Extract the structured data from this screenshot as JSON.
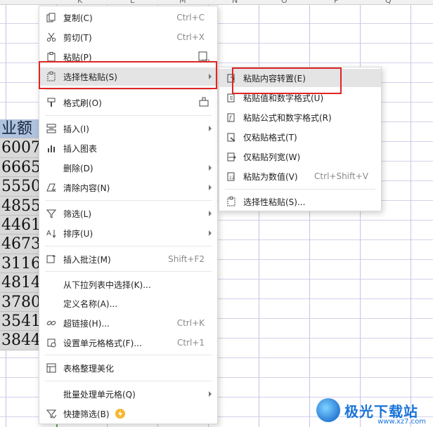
{
  "sheet": {
    "column_letters": [
      "K",
      "L",
      "M",
      "N",
      "O",
      "P",
      "Q"
    ],
    "header_cell": "业额",
    "cells": [
      "6007",
      "6665",
      "5550",
      "4855",
      "4461",
      "4673",
      "3116",
      "4814",
      "3780",
      "3541",
      "3844"
    ]
  },
  "main_menu": {
    "items": [
      {
        "label": "复制(C)",
        "shortcut": "Ctrl+C",
        "icon": "copy-icon"
      },
      {
        "label": "剪切(T)",
        "shortcut": "Ctrl+X",
        "icon": "scissors-icon"
      },
      {
        "label": "粘贴(P)",
        "shortcut": "",
        "icon": "paste-icon",
        "right_icon": "paste-value-icon"
      },
      {
        "label": "选择性粘贴(S)",
        "shortcut": "",
        "icon": "paste-special-icon",
        "submenu": true,
        "highlighted": true
      },
      {
        "label": "格式刷(O)",
        "shortcut": "",
        "icon": "format-brush-icon",
        "right_icon": "brush-icon"
      },
      {
        "label": "插入(I)",
        "shortcut": "",
        "icon": "insert-icon",
        "submenu": true
      },
      {
        "label": "插入图表",
        "shortcut": "",
        "icon": "chart-icon"
      },
      {
        "label": "删除(D)",
        "shortcut": "",
        "icon": "",
        "submenu": true
      },
      {
        "label": "清除内容(N)",
        "shortcut": "",
        "icon": "eraser-icon",
        "submenu": true
      },
      {
        "label": "筛选(L)",
        "shortcut": "",
        "icon": "filter-icon",
        "submenu": true
      },
      {
        "label": "排序(U)",
        "shortcut": "",
        "icon": "sort-icon",
        "submenu": true
      },
      {
        "label": "插入批注(M)",
        "shortcut": "Shift+F2",
        "icon": "comment-icon"
      },
      {
        "label": "从下拉列表中选择(K)...",
        "shortcut": "",
        "icon": ""
      },
      {
        "label": "定义名称(A)...",
        "shortcut": "",
        "icon": ""
      },
      {
        "label": "超链接(H)...",
        "shortcut": "Ctrl+K",
        "icon": "link-icon"
      },
      {
        "label": "设置单元格格式(F)...",
        "shortcut": "Ctrl+1",
        "icon": "cell-format-icon"
      },
      {
        "label": "表格整理美化",
        "shortcut": "",
        "icon": "beautify-icon"
      },
      {
        "label": "批量处理单元格(Q)",
        "shortcut": "",
        "icon": "",
        "submenu": true
      },
      {
        "label": "快捷筛选(B)",
        "shortcut": "",
        "icon": "quick-filter-icon",
        "badge_icon": "lightning-badge-icon"
      }
    ]
  },
  "sub_menu": {
    "items": [
      {
        "label": "粘贴内容转置(E)",
        "shortcut": "",
        "icon": "transpose-icon",
        "highlighted": true
      },
      {
        "label": "粘贴值和数字格式(U)",
        "shortcut": "",
        "icon": "paste-values-format-icon"
      },
      {
        "label": "粘贴公式和数字格式(R)",
        "shortcut": "",
        "icon": "paste-formula-icon"
      },
      {
        "label": "仅粘贴格式(T)",
        "shortcut": "",
        "icon": "paste-format-icon"
      },
      {
        "label": "仅粘贴列宽(W)",
        "shortcut": "",
        "icon": "paste-width-icon"
      },
      {
        "label": "粘贴为数值(V)",
        "shortcut": "Ctrl+Shift+V",
        "icon": "paste-number-icon"
      },
      {
        "label": "选择性粘贴(S)...",
        "shortcut": "",
        "icon": "paste-special-icon"
      }
    ]
  },
  "watermark": {
    "text": "极光下载站",
    "url": "www.xz7.com"
  },
  "colors": {
    "highlight_box": "#e02424",
    "cell_header": "#aec3de",
    "menu_hover": "#e4e4e4"
  }
}
